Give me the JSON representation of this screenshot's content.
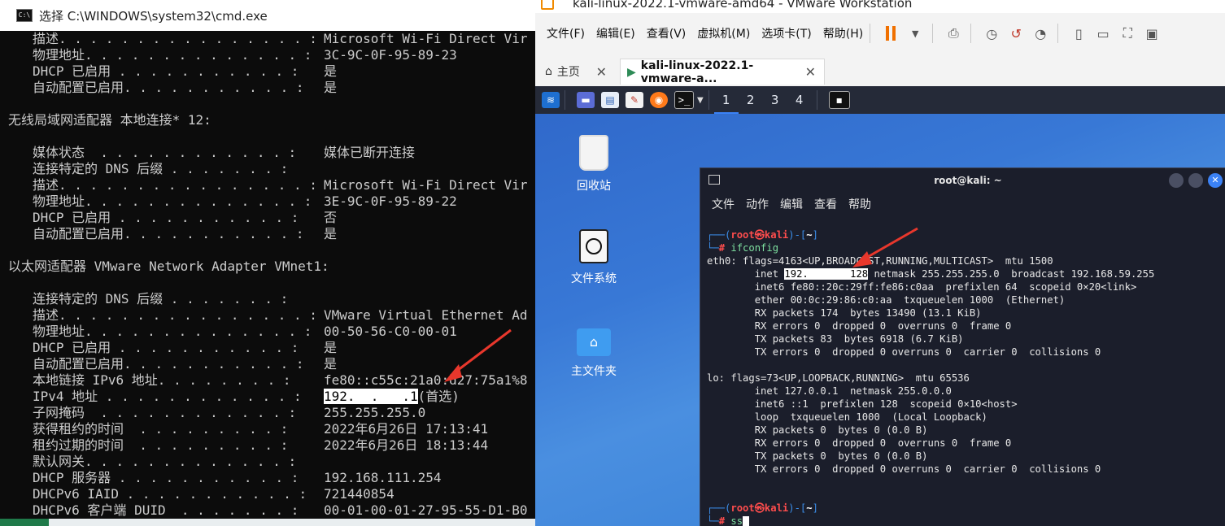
{
  "cmd": {
    "title": "选择 C:\\WINDOWS\\system32\\cmd.exe",
    "lines": [
      {
        "k": "描述. . . . . . . . . . . . . . . . :",
        "v": "Microsoft Wi-Fi Direct Vir",
        "indent": true
      },
      {
        "k": "物理地址. . . . . . . . . . . . . . :",
        "v": "3C-9C-0F-95-89-23",
        "indent": true
      },
      {
        "k": "DHCP 已启用 . . . . . . . . . . . :",
        "v": "是",
        "indent": true
      },
      {
        "k": "自动配置已启用. . . . . . . . . . . :",
        "v": "是",
        "indent": true
      },
      {
        "k": "",
        "v": "",
        "indent": false
      },
      {
        "k": "无线局域网适配器 本地连接* 12:",
        "v": "",
        "indent": false
      },
      {
        "k": "",
        "v": "",
        "indent": false
      },
      {
        "k": "媒体状态  . . . . . . . . . . . . :",
        "v": "媒体已断开连接",
        "indent": true
      },
      {
        "k": "连接特定的 DNS 后缀 . . . . . . . :",
        "v": "",
        "indent": true
      },
      {
        "k": "描述. . . . . . . . . . . . . . . . :",
        "v": "Microsoft Wi-Fi Direct Vir",
        "indent": true
      },
      {
        "k": "物理地址. . . . . . . . . . . . . . :",
        "v": "3E-9C-0F-95-89-22",
        "indent": true
      },
      {
        "k": "DHCP 已启用 . . . . . . . . . . . :",
        "v": "否",
        "indent": true
      },
      {
        "k": "自动配置已启用. . . . . . . . . . . :",
        "v": "是",
        "indent": true
      },
      {
        "k": "",
        "v": "",
        "indent": false
      },
      {
        "k": "以太网适配器 VMware Network Adapter VMnet1:",
        "v": "",
        "indent": false
      },
      {
        "k": "",
        "v": "",
        "indent": false
      },
      {
        "k": "连接特定的 DNS 后缀 . . . . . . . :",
        "v": "",
        "indent": true
      },
      {
        "k": "描述. . . . . . . . . . . . . . . . :",
        "v": "VMware Virtual Ethernet Ad",
        "indent": true
      },
      {
        "k": "物理地址. . . . . . . . . . . . . . :",
        "v": "00-50-56-C0-00-01",
        "indent": true
      },
      {
        "k": "DHCP 已启用 . . . . . . . . . . . :",
        "v": "是",
        "indent": true
      },
      {
        "k": "自动配置已启用. . . . . . . . . . . :",
        "v": "是",
        "indent": true
      },
      {
        "k": "本地链接 IPv6 地址. . . . . . . . :",
        "v": "fe80::c55c:21a0:d27:75a1%8",
        "indent": true
      },
      {
        "k": "IPv4 地址 . . . . . . . . . . . . :",
        "v": "",
        "mask": "192.  .   .1",
        "after": "(首选)",
        "indent": true
      },
      {
        "k": "子网掩码  . . . . . . . . . . . . :",
        "v": "255.255.255.0",
        "indent": true
      },
      {
        "k": "获得租约的时间  . . . . . . . . . :",
        "v": "2022年6月26日 17:13:41",
        "indent": true
      },
      {
        "k": "租约过期的时间  . . . . . . . . . :",
        "v": "2022年6月26日 18:13:44",
        "indent": true
      },
      {
        "k": "默认网关. . . . . . . . . . . . . :",
        "v": "",
        "indent": true
      },
      {
        "k": "DHCP 服务器 . . . . . . . . . . . :",
        "v": "192.168.111.254",
        "indent": true
      },
      {
        "k": "DHCPv6 IAID . . . . . . . . . . . :",
        "v": "721440854",
        "indent": true
      },
      {
        "k": "DHCPv6 客户端 DUID  . . . . . . . :",
        "v": "00-01-00-01-27-95-55-D1-B0",
        "indent": true
      }
    ]
  },
  "vmware": {
    "title": "kali-linux-2022.1-vmware-amd64 - VMware Workstation",
    "menu": [
      "文件(F)",
      "编辑(E)",
      "查看(V)",
      "虚拟机(M)",
      "选项卡(T)",
      "帮助(H)"
    ],
    "tabs": {
      "home": "主页",
      "vm": "kali-linux-2022.1-vmware-a..."
    },
    "accent": "#f07000"
  },
  "kali": {
    "workspaces": [
      "1",
      "2",
      "3",
      "4"
    ],
    "desktop_icons": [
      "回收站",
      "文件系统",
      "主文件夹"
    ],
    "terminal": {
      "title": "root@kali: ~",
      "menu": [
        "文件",
        "动作",
        "编辑",
        "查看",
        "帮助"
      ],
      "prompt_user": "root㉿kali",
      "prompt_dir": "~",
      "command1": "ifconfig",
      "command2": "ss",
      "output": [
        "eth0: flags=4163<UP,BROADCAST,RUNNING,MULTICAST>  mtu 1500",
        "        inet |192.       128| netmask 255.255.255.0  broadcast 192.168.59.255",
        "        inet6 fe80::20c:29ff:fe86:c0aa  prefixlen 64  scopeid 0×20<link>",
        "        ether 00:0c:29:86:c0:aa  txqueuelen 1000  (Ethernet)",
        "        RX packets 174  bytes 13490 (13.1 KiB)",
        "        RX errors 0  dropped 0  overruns 0  frame 0",
        "        TX packets 83  bytes 6918 (6.7 KiB)",
        "        TX errors 0  dropped 0 overruns 0  carrier 0  collisions 0",
        "",
        "lo: flags=73<UP,LOOPBACK,RUNNING>  mtu 65536",
        "        inet 127.0.0.1  netmask 255.0.0.0",
        "        inet6 ::1  prefixlen 128  scopeid 0×10<host>",
        "        loop  txqueuelen 1000  (Local Loopback)",
        "        RX packets 0  bytes 0 (0.0 B)",
        "        RX errors 0  dropped 0  overruns 0  frame 0",
        "        TX packets 0  bytes 0 (0.0 B)",
        "        TX errors 0  dropped 0 overruns 0  carrier 0  collisions 0"
      ]
    }
  },
  "annotation_color": "#e8372c"
}
